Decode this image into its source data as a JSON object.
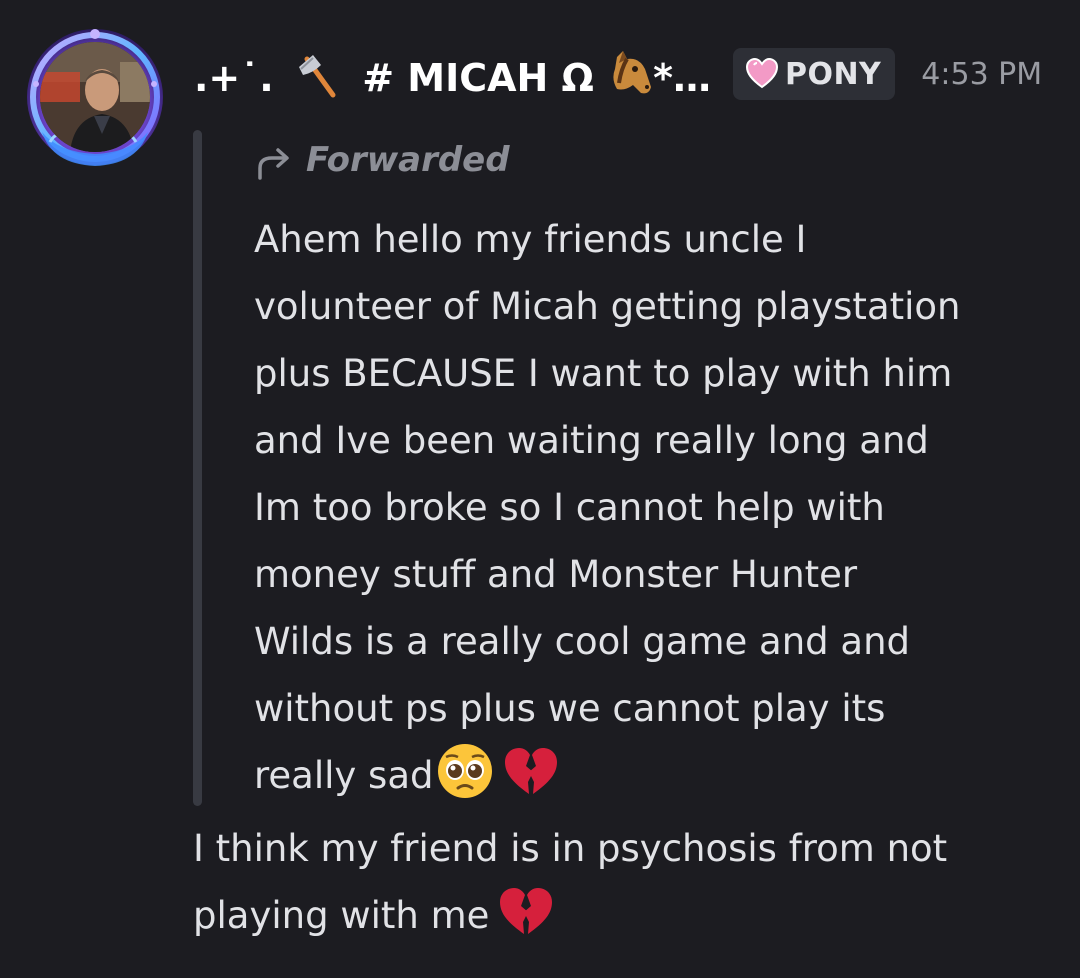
{
  "author": {
    "display_name": ".+˙. 🪓 # MICAH Ω🐴*…",
    "name_prefix": ".+˙.",
    "name_main": "# MICAH Ω",
    "name_suffix": "*…",
    "avatar_icon": "avatar-photo"
  },
  "tag": {
    "icon": "pink-heart-icon",
    "label": "PONY"
  },
  "timestamp": "4:53 PM",
  "forward": {
    "label": "Forwarded",
    "icon": "forward-arrow-icon",
    "lines": [
      "Ahem hello my friends uncle I",
      "volunteer of Micah getting playstation",
      "plus BECAUSE I want to play with him",
      "and Ive been waiting really long and",
      "Im too broke so I cannot help with",
      "money stuff and Monster Hunter",
      "Wilds is a really cool game and and",
      "without ps plus we cannot play its",
      "really sad"
    ],
    "end_emojis": [
      "pleading-face-icon",
      "broken-heart-icon"
    ]
  },
  "message": {
    "lines": [
      "I think my friend is in psychosis from not",
      "playing with me"
    ],
    "end_emoji": "broken-heart-icon"
  },
  "colors": {
    "background": "#1c1c21",
    "text": "#e1e2e6",
    "muted": "#9a9ca3",
    "tag_bg": "#2d2f36",
    "forward_bar": "#383a42"
  }
}
